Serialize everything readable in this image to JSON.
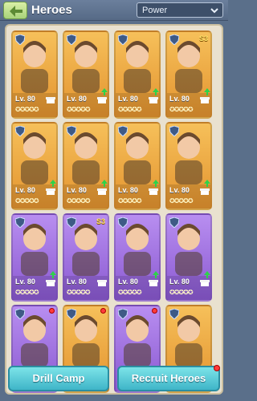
{
  "header": {
    "title": "Heroes",
    "sort_value": "Power"
  },
  "cards": [
    {
      "color": "orange",
      "level": "Lv. 80",
      "stars": "✪✪✪✪✪",
      "badge": "",
      "dot": false,
      "up": false
    },
    {
      "color": "orange",
      "level": "Lv. 80",
      "stars": "✪✪✪✪✪",
      "badge": "",
      "dot": false,
      "up": true
    },
    {
      "color": "orange",
      "level": "Lv. 80",
      "stars": "✪✪✪✪✪",
      "badge": "",
      "dot": false,
      "up": true
    },
    {
      "color": "orange",
      "level": "Lv. 80",
      "stars": "✪✪✪✪✪",
      "badge": "S3",
      "dot": false,
      "up": true
    },
    {
      "color": "orange",
      "level": "Lv. 80",
      "stars": "✪✪✪✪✪",
      "badge": "",
      "dot": false,
      "up": true
    },
    {
      "color": "orange",
      "level": "Lv. 80",
      "stars": "✪✪✪✪✪",
      "badge": "",
      "dot": false,
      "up": true
    },
    {
      "color": "orange",
      "level": "Lv. 80",
      "stars": "✪✪✪✪✪",
      "badge": "",
      "dot": false,
      "up": true
    },
    {
      "color": "orange",
      "level": "Lv. 80",
      "stars": "✪✪✪✪✪",
      "badge": "",
      "dot": false,
      "up": true
    },
    {
      "color": "purple",
      "level": "Lv. 80",
      "stars": "✪✪✪✪✪",
      "badge": "",
      "dot": false,
      "up": true
    },
    {
      "color": "purple",
      "level": "Lv. 80",
      "stars": "✪✪✪✪✪",
      "badge": "S3",
      "dot": false,
      "up": false
    },
    {
      "color": "purple",
      "level": "Lv. 80",
      "stars": "✪✪✪✪✪",
      "badge": "",
      "dot": false,
      "up": true
    },
    {
      "color": "purple",
      "level": "Lv. 80",
      "stars": "✪✪✪✪✪",
      "badge": "",
      "dot": false,
      "up": true
    },
    {
      "color": "purple",
      "level": "",
      "stars": "",
      "badge": "",
      "dot": true,
      "up": false
    },
    {
      "color": "orange",
      "level": "",
      "stars": "",
      "badge": "",
      "dot": true,
      "up": false
    },
    {
      "color": "purple",
      "level": "",
      "stars": "",
      "badge": "",
      "dot": true,
      "up": false
    },
    {
      "color": "orange",
      "level": "",
      "stars": "",
      "badge": "",
      "dot": false,
      "up": false
    }
  ],
  "buttons": {
    "drill_camp": "Drill Camp",
    "recruit_heroes": "Recruit Heroes"
  }
}
